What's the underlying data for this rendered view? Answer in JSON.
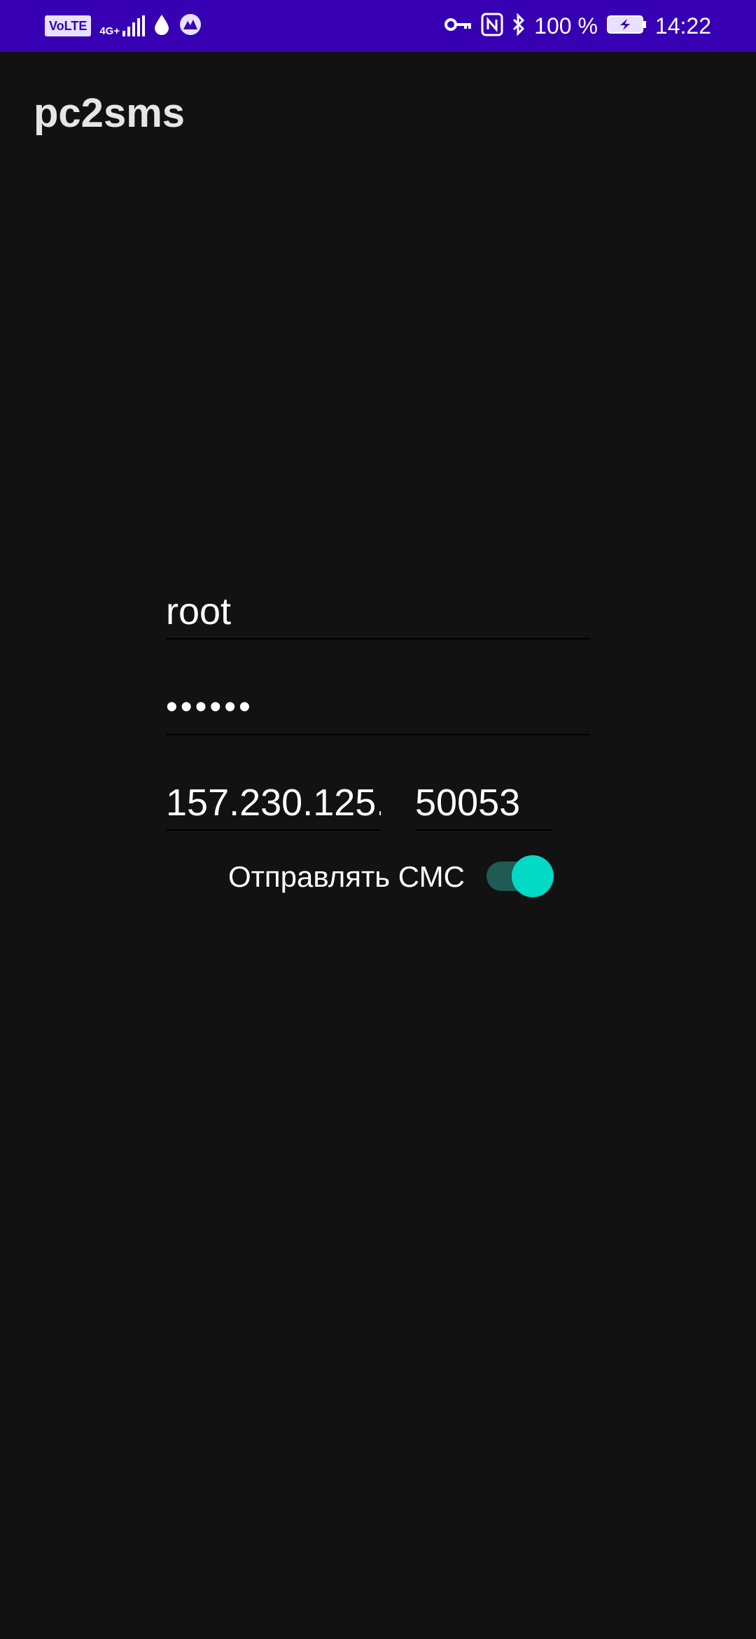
{
  "status_bar": {
    "volte": "VoLTE",
    "network": "4G+",
    "battery": "100 %",
    "time": "14:22"
  },
  "app": {
    "title": "pc2sms"
  },
  "form": {
    "username_value": "root",
    "password_value": "••••••",
    "host_value": "157.230.125.",
    "port_value": "50053",
    "send_sms_label": "Отправлять СМС",
    "send_sms_enabled": true
  },
  "colors": {
    "status_bar": "#3700b3",
    "background": "#121212",
    "accent": "#03dac5",
    "switch_track": "#1f5a54"
  },
  "icons": {
    "status_left": [
      "volte-icon",
      "signal-icon",
      "drop-icon",
      "vpn-app-icon"
    ],
    "status_right": [
      "key-icon",
      "nfc-icon",
      "bluetooth-icon",
      "battery-charging-icon"
    ]
  }
}
